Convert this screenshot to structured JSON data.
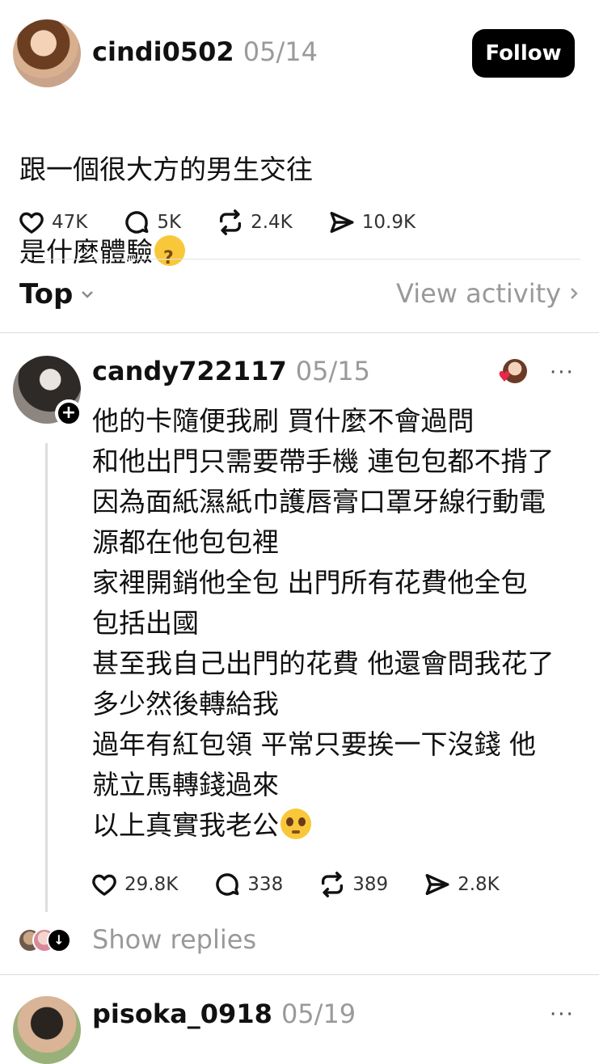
{
  "post": {
    "username": "cindi0502",
    "date": "05/14",
    "follow_label": "Follow",
    "text_line1": "跟一個很大方的男生交往",
    "text_line2": "是什麼體驗",
    "emoji": "thinking-face",
    "stats": {
      "likes": "47K",
      "comments": "5K",
      "reposts": "2.4K",
      "shares": "10.9K"
    }
  },
  "sort_bar": {
    "sort_label": "Top",
    "activity_label": "View activity"
  },
  "reply": {
    "username": "candy722117",
    "date": "05/15",
    "more": "···",
    "lines": [
      "他的卡隨便我刷 買什麼不會過問",
      "和他出門只需要帶手機 連包包都不揹了",
      "因為面紙濕紙巾護唇膏口罩牙線行動電",
      "源都在他包包裡",
      "家裡開銷他全包 出門所有花費他全包",
      "包括出國",
      "甚至我自己出門的花費 他還會問我花了",
      "多少然後轉給我",
      "過年有紅包領 平常只要挨一下沒錢 他",
      "就立馬轉錢過來",
      "以上真實我老公"
    ],
    "emoji": "pleading-face",
    "stats": {
      "likes": "29.8K",
      "comments": "338",
      "reposts": "389",
      "shares": "2.8K"
    },
    "show_replies": "Show replies"
  },
  "next_reply": {
    "username": "pisoka_0918",
    "date": "05/19",
    "more": "···"
  },
  "colors": {
    "accent": "#000000",
    "muted": "#999999",
    "heart": "#e8274b"
  }
}
